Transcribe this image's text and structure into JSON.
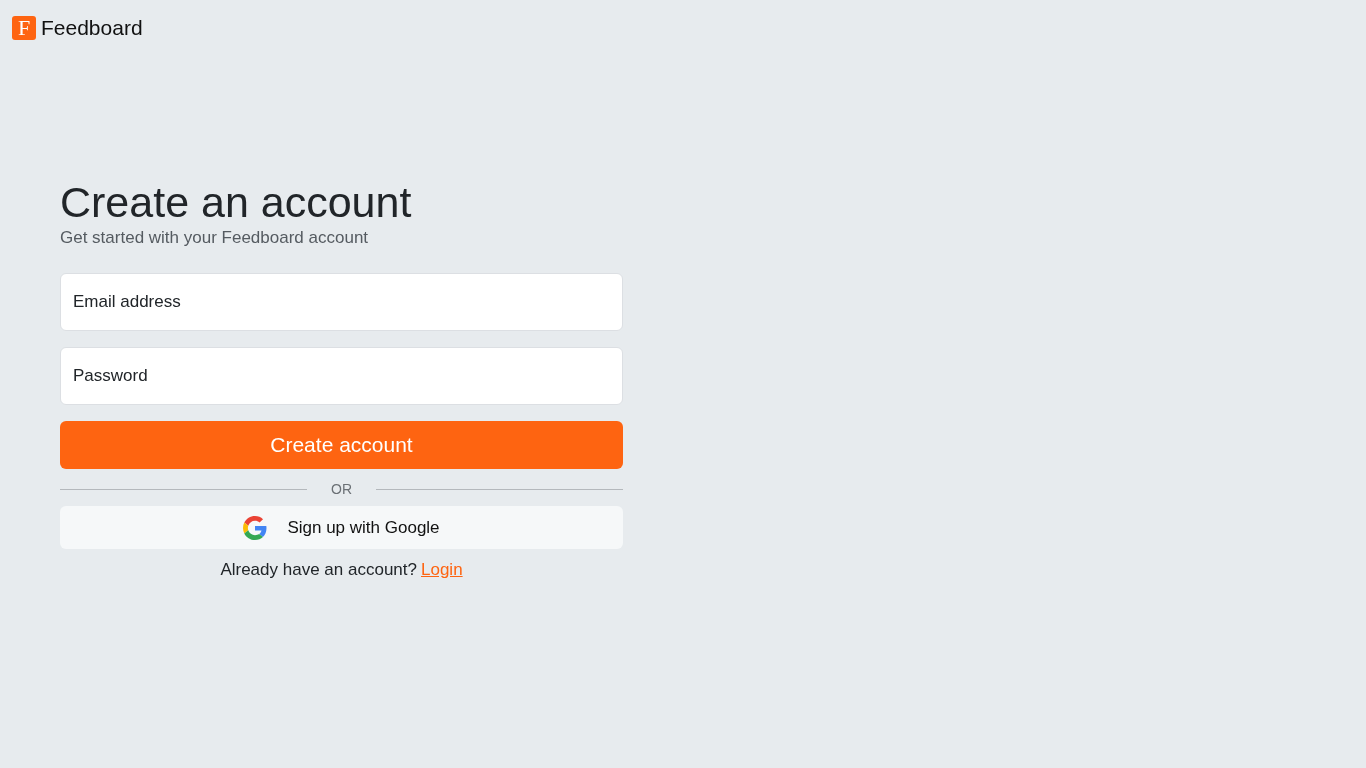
{
  "header": {
    "logo": {
      "letter": "F"
    },
    "brand": "Feedboard"
  },
  "form": {
    "title": "Create an account",
    "subtitle": "Get started with your Feedboard account",
    "email_field": {
      "placeholder": "Email address"
    },
    "password_field": {
      "placeholder": "Password"
    },
    "submit": "Create account",
    "divider": "OR",
    "google_button": "Sign up with Google",
    "footer": {
      "prompt": "Already have an account?",
      "link": "Login"
    }
  }
}
